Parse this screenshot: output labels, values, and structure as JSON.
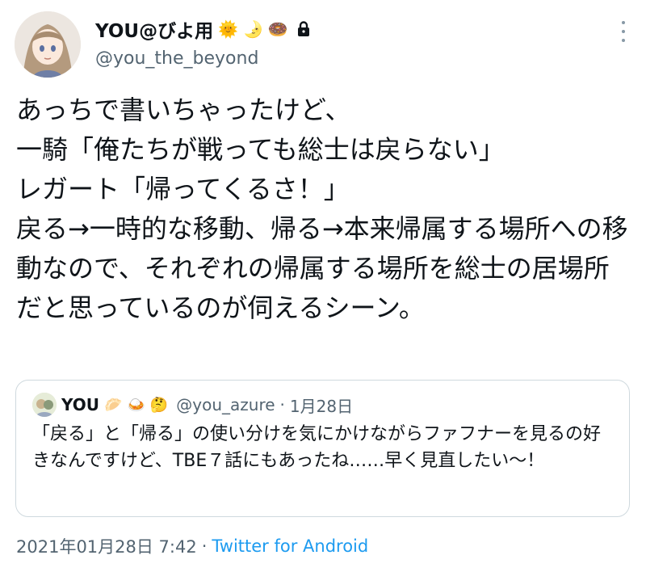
{
  "author": {
    "display_name": "YOU@びよ用",
    "emojis": [
      "🌞",
      "🌛",
      "🍩"
    ],
    "handle": "@you_the_beyond",
    "protected_icon": "lock-icon"
  },
  "menu_icon": "more-vertical-icon",
  "tweet": {
    "text": "あっちで書いちゃったけど、\n一騎「俺たちが戦っても総士は戻らない」\nレガート「帰ってくるさ！」\n戻る→一時的な移動、帰る→本来帰属する場所への移動なので、それぞれの帰属する場所を総士の居場所だと思っているのが伺えるシーン。"
  },
  "quote": {
    "display_name": "YOU",
    "emojis": [
      "🥟",
      "🍛",
      "🤔"
    ],
    "handle": "@you_azure",
    "separator": "·",
    "date": "1月28日",
    "text": "「戻る」と「帰る」の使い分けを気にかけながらファフナーを見るの好きなんですけど、TBE７話にもあったね……早く見直したい〜！"
  },
  "meta": {
    "datetime": "2021年01月28日 7:42",
    "separator": "·",
    "source": "Twitter for Android"
  },
  "colors": {
    "text": "#0f1419",
    "secondary": "#536471",
    "link": "#1d9bf0",
    "border": "#cfd9de"
  }
}
